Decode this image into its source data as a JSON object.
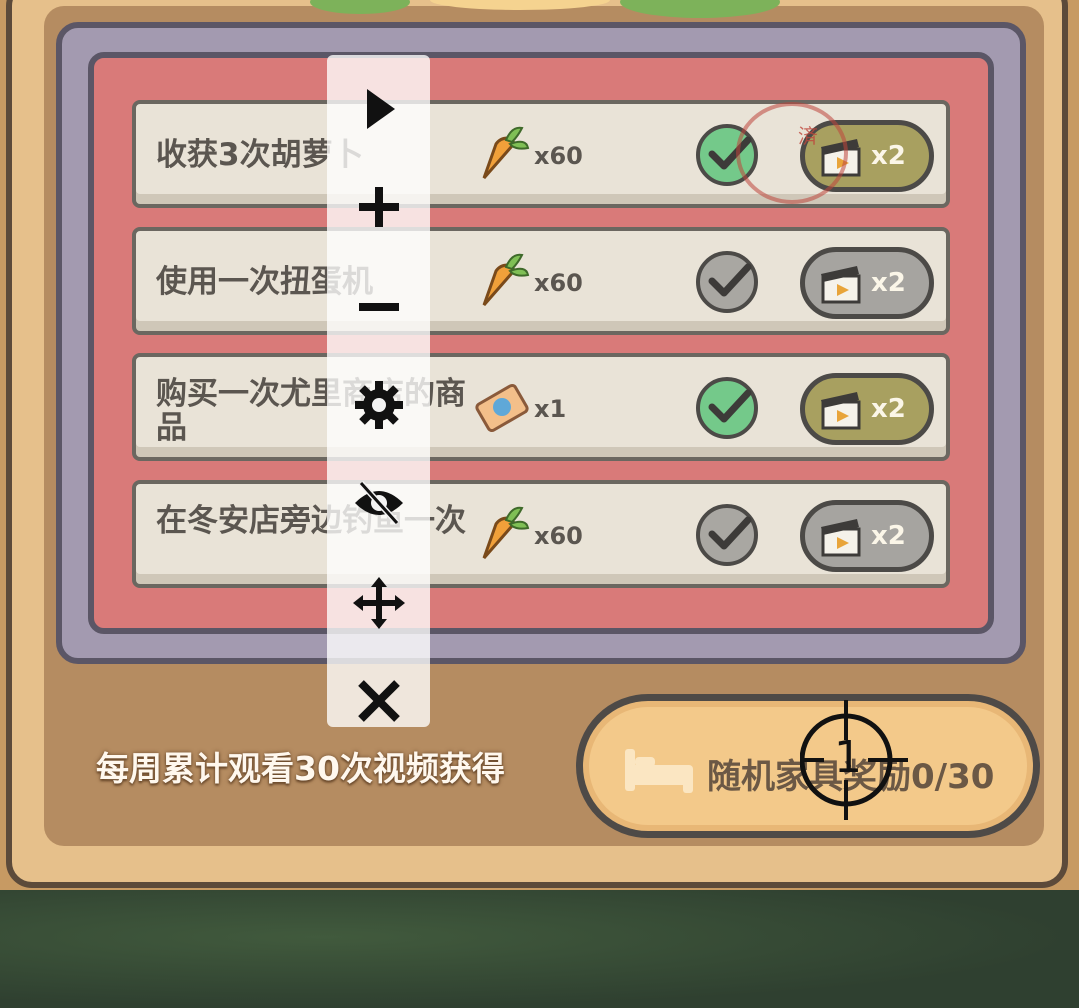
{
  "tasks": [
    {
      "title": "收获3次胡萝卜",
      "reward_icon": "carrot-icon",
      "reward_count": "x60",
      "checked": true,
      "video_multiplier": "x2",
      "video_active": true
    },
    {
      "title": "使用一次扭蛋机",
      "reward_icon": "carrot-icon",
      "reward_count": "x60",
      "checked": false,
      "video_multiplier": "x2",
      "video_active": false
    },
    {
      "title": "购买一次尤里商店的商品",
      "reward_icon": "ticket-icon",
      "reward_count": "x1",
      "checked": true,
      "video_multiplier": "x2",
      "video_active": true
    },
    {
      "title": "在冬安店旁边钓鱼一次",
      "reward_icon": "carrot-icon",
      "reward_count": "x60",
      "checked": false,
      "video_multiplier": "x2",
      "video_active": false
    }
  ],
  "stamp_text": "済",
  "weekly": {
    "label": "每周累计观看30次视频获得",
    "button_label": "随机家具奖励0/30"
  },
  "toolbar": {
    "items": [
      "play-icon",
      "plus-icon",
      "minus-icon",
      "gear-icon",
      "eye-off-icon",
      "move-icon",
      "close-icon"
    ]
  },
  "crosshair_label": "1",
  "colors": {
    "check_done": "#74c98a",
    "check_pending": "#a9a7a2",
    "video_active": "#a8a060",
    "video_inactive": "#a6a4a0",
    "furniture_button": "#f3c98a"
  }
}
